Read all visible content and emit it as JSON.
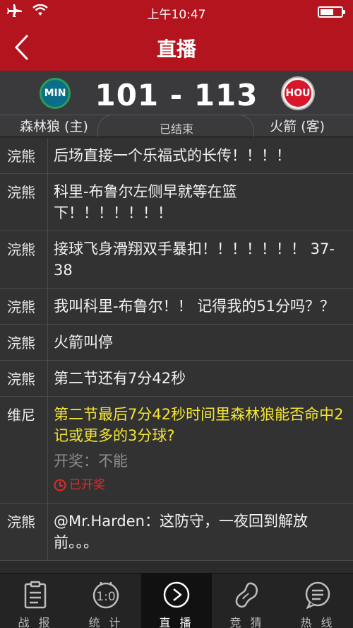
{
  "status": {
    "time": "上午10:47"
  },
  "nav": {
    "title": "直播"
  },
  "game": {
    "home_abbr": "MIN",
    "away_abbr": "HOU",
    "score": "101 - 113",
    "home_name": "森林狼 (主)",
    "away_name": "火箭 (客)",
    "status": "已结束"
  },
  "feed": [
    {
      "author": "浣熊",
      "text": "后场直接一个乐福式的长传！！！！"
    },
    {
      "author": "浣熊",
      "text": "科里-布鲁尔左侧早就等在篮下！！！！！！！"
    },
    {
      "author": "浣熊",
      "text": "接球飞身滑翔双手暴扣！！！！！！！ 37-38"
    },
    {
      "author": "浣熊",
      "text": "我叫科里-布鲁尔！！ 记得我的51分吗？？"
    },
    {
      "author": "浣熊",
      "text": "火箭叫停"
    },
    {
      "author": "浣熊",
      "text": "第二节还有7分42秒"
    },
    {
      "author": "维尼",
      "question": "第二节最后7分42秒时间里森林狼能否命中2记或更多的3分球?",
      "result": "开奖：不能",
      "opened": "已开奖"
    },
    {
      "author": "浣熊",
      "text": "@Mr.Harden：这防守，一夜回到解放前。。。"
    }
  ],
  "tabs": [
    {
      "label": "战 报",
      "icon": "report-icon"
    },
    {
      "label": "统 计",
      "icon": "stats-icon"
    },
    {
      "label": "直 播",
      "icon": "play-icon",
      "active": true
    },
    {
      "label": "竞 猜",
      "icon": "bean-icon"
    },
    {
      "label": "热 线",
      "icon": "chat-icon"
    }
  ]
}
